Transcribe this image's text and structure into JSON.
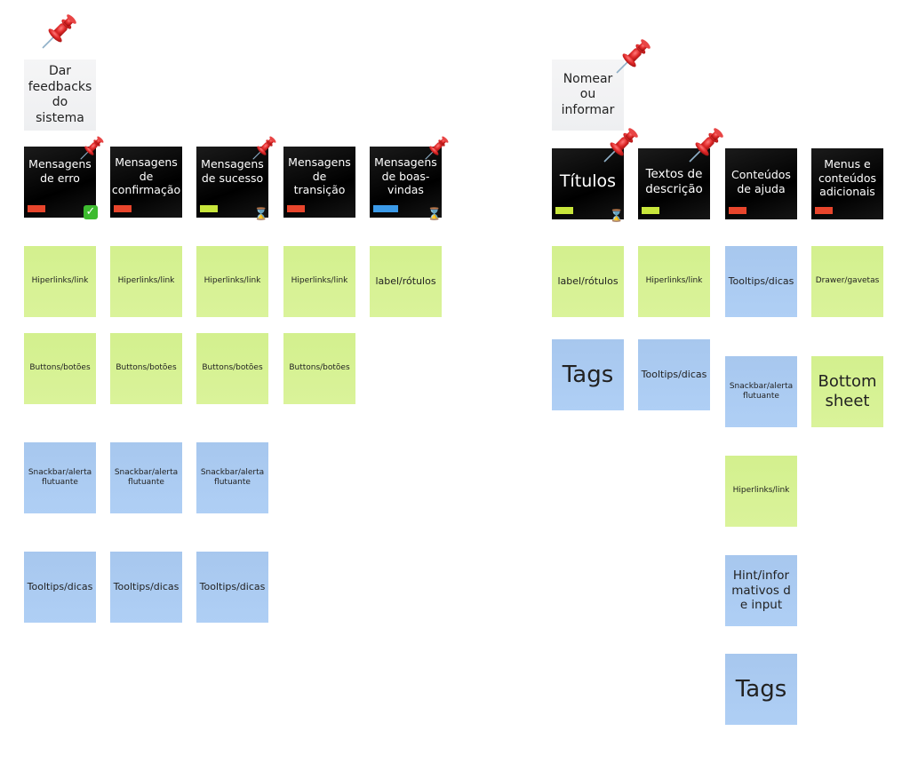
{
  "colors": {
    "white_note": "#f2f3f4",
    "black_note": "#0a0a0a",
    "green_note": "#d6f193",
    "blue_note": "#aacaf1",
    "tag_red": "#e8452c",
    "tag_green": "#c8e63b",
    "tag_blue": "#3b9ae8",
    "pin_red": "#d9202a"
  },
  "groups": [
    {
      "title": "Dar feedbacks do sistema",
      "categories": [
        {
          "label": "Mensagens de erro",
          "tag": "red",
          "pinned": true,
          "badge": "check-icon"
        },
        {
          "label": "Mensagens de confirmação",
          "tag": "red",
          "pinned": false,
          "badge": ""
        },
        {
          "label": "Mensagens de sucesso",
          "tag": "green",
          "pinned": true,
          "badge": "hourglass-icon"
        },
        {
          "label": "Mensagens de transição",
          "tag": "red",
          "pinned": false,
          "badge": ""
        },
        {
          "label": "Mensagens de boas-vindas",
          "tag": "blue",
          "pinned": true,
          "badge": "hourglass-icon"
        }
      ],
      "columns": [
        [
          "Hiperlinks/link",
          "Buttons/botões",
          "Snackbar/alerta flutuante",
          "Tooltips/dicas"
        ],
        [
          "Hiperlinks/link",
          "Buttons/botões",
          "Snackbar/alerta flutuante",
          "Tooltips/dicas"
        ],
        [
          "Hiperlinks/link",
          "Buttons/botões",
          "Snackbar/alerta flutuante",
          "Tooltips/dicas"
        ],
        [
          "Hiperlinks/link",
          "Buttons/botões"
        ],
        [
          "label/rótulos"
        ]
      ]
    },
    {
      "title": "Nomear ou informar",
      "categories": [
        {
          "label": "Títulos",
          "tag": "green",
          "pinned": true,
          "badge": "hourglass-icon"
        },
        {
          "label": "Textos de descrição",
          "tag": "green",
          "pinned": true,
          "badge": ""
        },
        {
          "label": "Conteúdos de ajuda",
          "tag": "red",
          "pinned": false,
          "badge": ""
        },
        {
          "label": "Menus e conteúdos adicionais",
          "tag": "red",
          "pinned": false,
          "badge": ""
        }
      ],
      "columns": [
        [
          "label/rótulos",
          "Tags"
        ],
        [
          "Hiperlinks/link",
          "Tooltips/dicas"
        ],
        [
          "Tooltips/dicas",
          "Snackbar/alerta flutuante",
          "Hiperlinks/link",
          "Hint/informativos de input",
          "Tags"
        ],
        [
          "Drawer/gavetas",
          "Bottom sheet"
        ]
      ]
    }
  ]
}
